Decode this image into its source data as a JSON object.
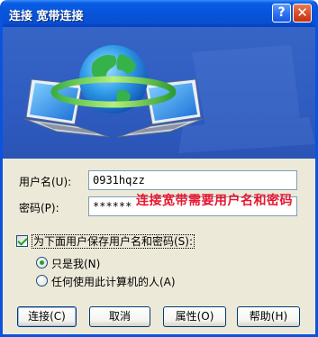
{
  "window": {
    "title": "连接 宽带连接",
    "help_glyph": "?",
    "close_glyph": "✕"
  },
  "form": {
    "username_label": "用户名(U):",
    "username_value": "0931hqzz",
    "password_label": "密码(P):",
    "password_value": "******",
    "annotation": "连接宽带需要用户名和密码",
    "save_checkbox_label": "为下面用户保存用户名和密码(S):",
    "save_checked": true,
    "radio_me_label": "只是我(N)",
    "radio_anyone_label": "任何使用此计算机的人(A)",
    "selected_radio": "me"
  },
  "buttons": {
    "connect": "连接(C)",
    "cancel": "取消",
    "properties": "属性(O)",
    "help": "帮助(H)"
  },
  "colors": {
    "titlebar": "#0554d9",
    "dialog_bg": "#ece9d8",
    "banner_bg": "#2f5cc0",
    "annotation": "#e8162e"
  }
}
